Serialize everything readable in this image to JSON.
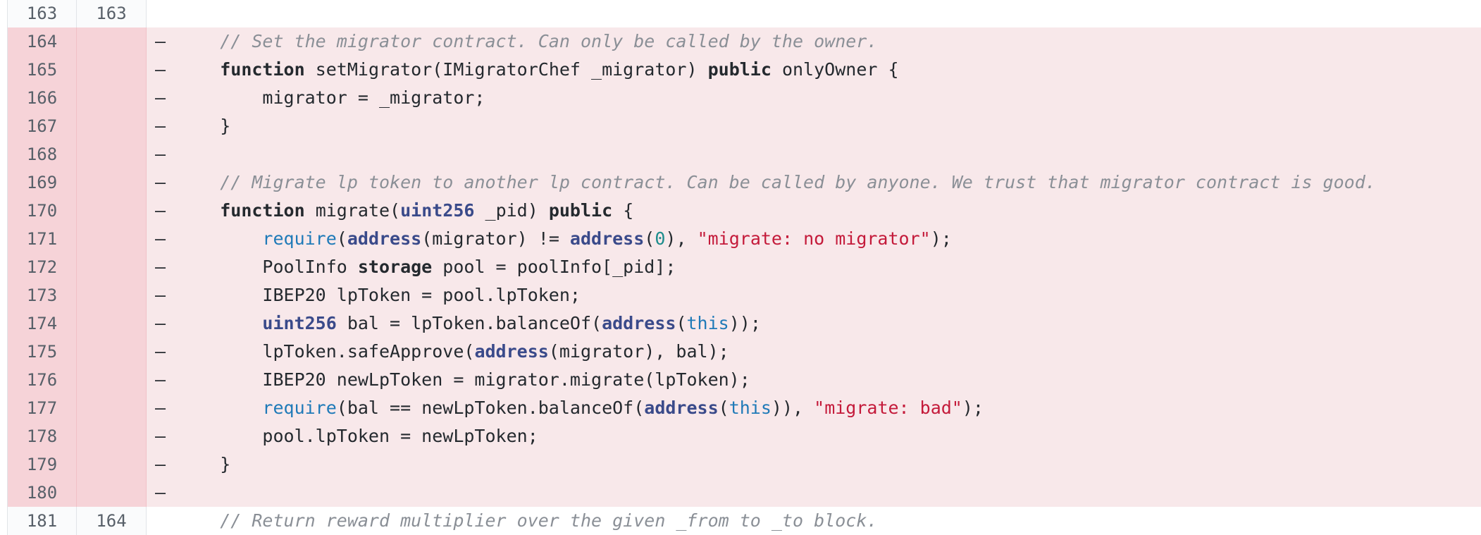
{
  "diff": {
    "rows": [
      {
        "kind": "ctx",
        "old": "163",
        "new": "163",
        "marker": " ",
        "tokens": [
          {
            "c": "tok-plain",
            "t": ""
          }
        ]
      },
      {
        "kind": "del",
        "old": "164",
        "new": "",
        "marker": "–",
        "tokens": [
          {
            "c": "tok-plain",
            "t": "    "
          },
          {
            "c": "tok-cmt",
            "t": "// Set the migrator contract. Can only be called by the owner."
          }
        ]
      },
      {
        "kind": "del",
        "old": "165",
        "new": "",
        "marker": "–",
        "tokens": [
          {
            "c": "tok-plain",
            "t": "    "
          },
          {
            "c": "tok-kw",
            "t": "function"
          },
          {
            "c": "tok-plain",
            "t": " setMigrator(IMigratorChef _migrator) "
          },
          {
            "c": "tok-kw",
            "t": "public"
          },
          {
            "c": "tok-plain",
            "t": " onlyOwner {"
          }
        ]
      },
      {
        "kind": "del",
        "old": "166",
        "new": "",
        "marker": "–",
        "tokens": [
          {
            "c": "tok-plain",
            "t": "        migrator = _migrator;"
          }
        ]
      },
      {
        "kind": "del",
        "old": "167",
        "new": "",
        "marker": "–",
        "tokens": [
          {
            "c": "tok-plain",
            "t": "    }"
          }
        ]
      },
      {
        "kind": "del",
        "old": "168",
        "new": "",
        "marker": "–",
        "tokens": [
          {
            "c": "tok-plain",
            "t": ""
          }
        ]
      },
      {
        "kind": "del",
        "old": "169",
        "new": "",
        "marker": "–",
        "tokens": [
          {
            "c": "tok-plain",
            "t": "    "
          },
          {
            "c": "tok-cmt",
            "t": "// Migrate lp token to another lp contract. Can be called by anyone. We trust that migrator contract is good."
          }
        ]
      },
      {
        "kind": "del",
        "old": "170",
        "new": "",
        "marker": "–",
        "tokens": [
          {
            "c": "tok-plain",
            "t": "    "
          },
          {
            "c": "tok-kw",
            "t": "function"
          },
          {
            "c": "tok-plain",
            "t": " migrate("
          },
          {
            "c": "tok-type",
            "t": "uint256"
          },
          {
            "c": "tok-plain",
            "t": " _pid) "
          },
          {
            "c": "tok-kw",
            "t": "public"
          },
          {
            "c": "tok-plain",
            "t": " {"
          }
        ]
      },
      {
        "kind": "del",
        "old": "171",
        "new": "",
        "marker": "–",
        "tokens": [
          {
            "c": "tok-plain",
            "t": "        "
          },
          {
            "c": "tok-fn",
            "t": "require"
          },
          {
            "c": "tok-plain",
            "t": "("
          },
          {
            "c": "tok-type",
            "t": "address"
          },
          {
            "c": "tok-plain",
            "t": "(migrator) != "
          },
          {
            "c": "tok-type",
            "t": "address"
          },
          {
            "c": "tok-plain",
            "t": "("
          },
          {
            "c": "tok-num",
            "t": "0"
          },
          {
            "c": "tok-plain",
            "t": "), "
          },
          {
            "c": "tok-str",
            "t": "\"migrate: no migrator\""
          },
          {
            "c": "tok-plain",
            "t": ");"
          }
        ]
      },
      {
        "kind": "del",
        "old": "172",
        "new": "",
        "marker": "–",
        "tokens": [
          {
            "c": "tok-plain",
            "t": "        PoolInfo "
          },
          {
            "c": "tok-kw",
            "t": "storage"
          },
          {
            "c": "tok-plain",
            "t": " pool = poolInfo[_pid];"
          }
        ]
      },
      {
        "kind": "del",
        "old": "173",
        "new": "",
        "marker": "–",
        "tokens": [
          {
            "c": "tok-plain",
            "t": "        IBEP20 lpToken = pool.lpToken;"
          }
        ]
      },
      {
        "kind": "del",
        "old": "174",
        "new": "",
        "marker": "–",
        "tokens": [
          {
            "c": "tok-plain",
            "t": "        "
          },
          {
            "c": "tok-type",
            "t": "uint256"
          },
          {
            "c": "tok-plain",
            "t": " bal = lpToken.balanceOf("
          },
          {
            "c": "tok-type",
            "t": "address"
          },
          {
            "c": "tok-plain",
            "t": "("
          },
          {
            "c": "tok-this",
            "t": "this"
          },
          {
            "c": "tok-plain",
            "t": "));"
          }
        ]
      },
      {
        "kind": "del",
        "old": "175",
        "new": "",
        "marker": "–",
        "tokens": [
          {
            "c": "tok-plain",
            "t": "        lpToken.safeApprove("
          },
          {
            "c": "tok-type",
            "t": "address"
          },
          {
            "c": "tok-plain",
            "t": "(migrator), bal);"
          }
        ]
      },
      {
        "kind": "del",
        "old": "176",
        "new": "",
        "marker": "–",
        "tokens": [
          {
            "c": "tok-plain",
            "t": "        IBEP20 newLpToken = migrator.migrate(lpToken);"
          }
        ]
      },
      {
        "kind": "del",
        "old": "177",
        "new": "",
        "marker": "–",
        "tokens": [
          {
            "c": "tok-plain",
            "t": "        "
          },
          {
            "c": "tok-fn",
            "t": "require"
          },
          {
            "c": "tok-plain",
            "t": "(bal == newLpToken.balanceOf("
          },
          {
            "c": "tok-type",
            "t": "address"
          },
          {
            "c": "tok-plain",
            "t": "("
          },
          {
            "c": "tok-this",
            "t": "this"
          },
          {
            "c": "tok-plain",
            "t": ")), "
          },
          {
            "c": "tok-str",
            "t": "\"migrate: bad\""
          },
          {
            "c": "tok-plain",
            "t": ");"
          }
        ]
      },
      {
        "kind": "del",
        "old": "178",
        "new": "",
        "marker": "–",
        "tokens": [
          {
            "c": "tok-plain",
            "t": "        pool.lpToken = newLpToken;"
          }
        ]
      },
      {
        "kind": "del",
        "old": "179",
        "new": "",
        "marker": "–",
        "tokens": [
          {
            "c": "tok-plain",
            "t": "    }"
          }
        ]
      },
      {
        "kind": "del",
        "old": "180",
        "new": "",
        "marker": "–",
        "tokens": [
          {
            "c": "tok-plain",
            "t": ""
          }
        ]
      },
      {
        "kind": "ctx",
        "old": "181",
        "new": "164",
        "marker": " ",
        "tokens": [
          {
            "c": "tok-plain",
            "t": "    "
          },
          {
            "c": "tok-cmt",
            "t": "// Return reward multiplier over the given _from to _to block."
          }
        ]
      }
    ]
  }
}
